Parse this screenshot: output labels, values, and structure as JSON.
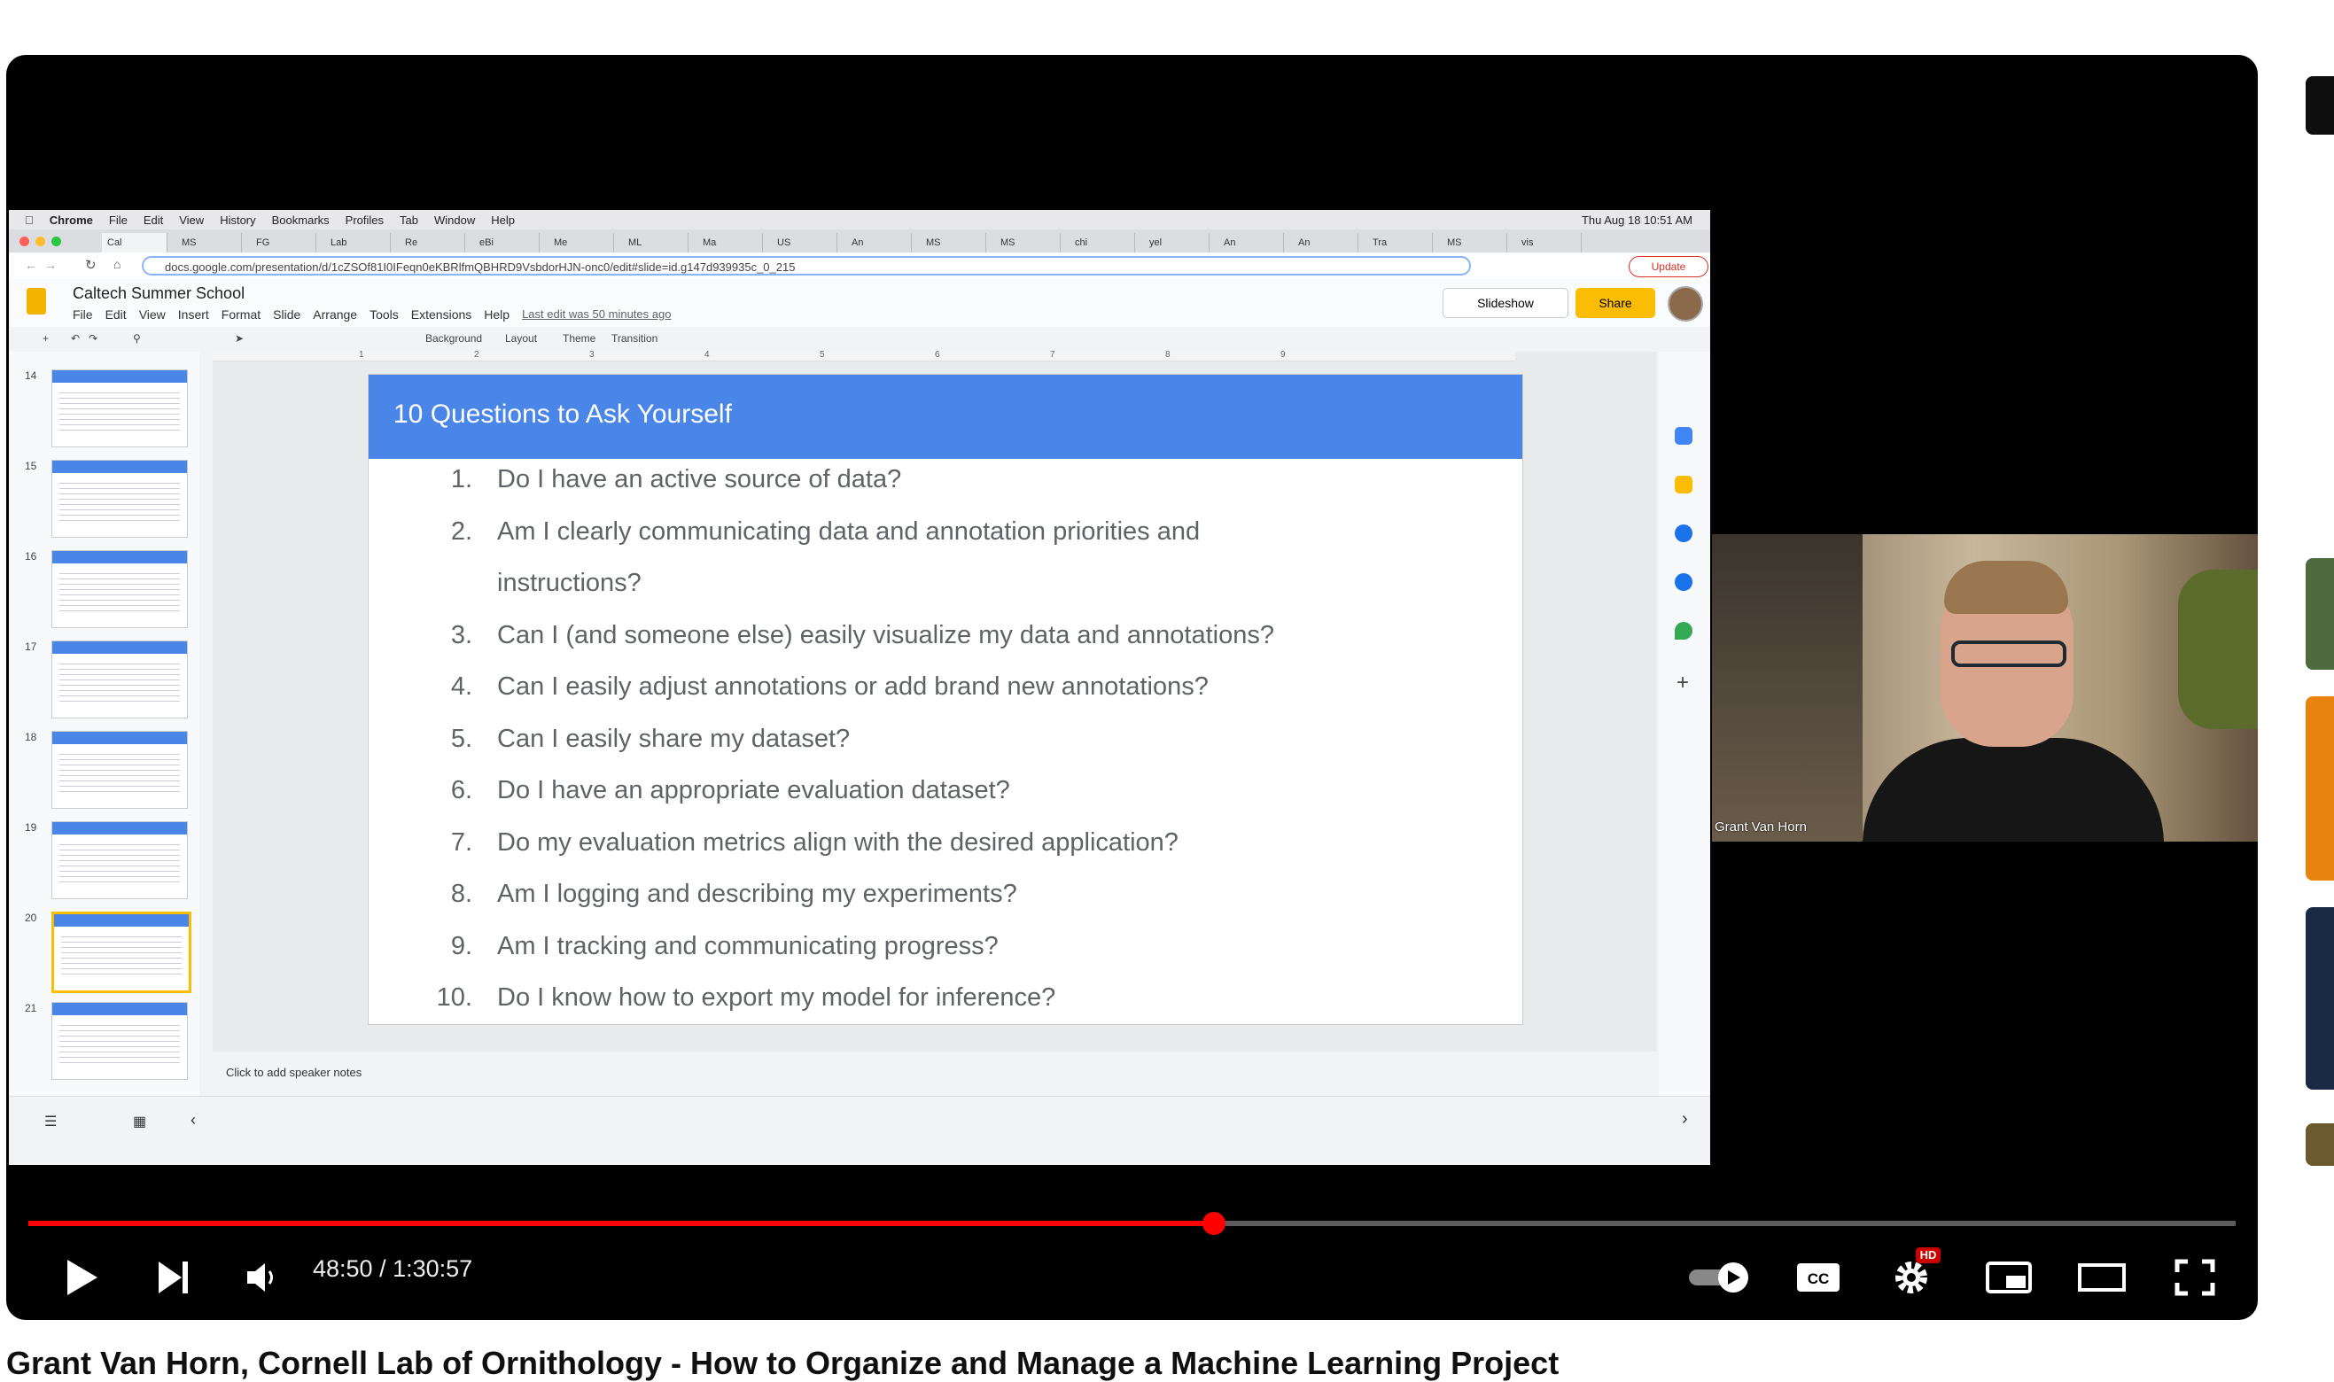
{
  "player": {
    "time_current": "48:50",
    "time_total": "1:30:57",
    "progress_fraction": 0.537,
    "hd_badge": "HD",
    "accent": "#ff0000"
  },
  "video_title": "Grant Van Horn, Cornell Lab of Ornithology - How to Organize and Manage a Machine Learning Project",
  "screen": {
    "mac_menu": [
      "Chrome",
      "File",
      "Edit",
      "View",
      "History",
      "Bookmarks",
      "Profiles",
      "Tab",
      "Window",
      "Help"
    ],
    "clock": "Thu Aug 18  10:51 AM",
    "tabs": [
      "Cal",
      "MS",
      "FG",
      "Lab",
      "Re",
      "eBi",
      "Me",
      "ML",
      "Ma",
      "US",
      "An",
      "MS",
      "MS",
      "chi",
      "yel",
      "An",
      "An",
      "Tra",
      "MS",
      "vis"
    ],
    "url": "docs.google.com/presentation/d/1cZSOf81I0IFeqn0eKBRlfmQBHRD9VsbdorHJN-onc0/edit#slide=id.g147d939935c_0_215",
    "update_label": "Update",
    "doc_title": "Caltech Summer School",
    "doc_menu": [
      "File",
      "Edit",
      "View",
      "Insert",
      "Format",
      "Slide",
      "Arrange",
      "Tools",
      "Extensions",
      "Help"
    ],
    "last_edit": "Last edit was 50 minutes ago",
    "slideshow_label": "Slideshow",
    "share_label": "Share",
    "toolbar": {
      "background": "Background",
      "layout": "Layout",
      "theme": "Theme",
      "transition": "Transition"
    },
    "slide_numbers": [
      "14",
      "15",
      "16",
      "17",
      "18",
      "19",
      "20",
      "21"
    ],
    "ruler_ticks": [
      "1",
      "2",
      "3",
      "4",
      "5",
      "6",
      "7",
      "8",
      "9"
    ],
    "slide_title": "10 Questions to Ask Yourself",
    "questions": [
      {
        "n": "1.",
        "t": "Do I have an active source of data?"
      },
      {
        "n": "2.",
        "t": "Am I clearly communicating data and annotation priorities and"
      },
      {
        "n": "",
        "t": "instructions?"
      },
      {
        "n": "3.",
        "t": "Can I (and someone else) easily visualize my data and annotations?"
      },
      {
        "n": "4.",
        "t": "Can I easily adjust annotations or add brand new annotations?"
      },
      {
        "n": "5.",
        "t": "Can I easily share my dataset?"
      },
      {
        "n": "6.",
        "t": "Do I have an appropriate evaluation dataset?"
      },
      {
        "n": "7.",
        "t": "Do my evaluation metrics align with the desired application?"
      },
      {
        "n": "8.",
        "t": "Am I logging and describing my experiments?"
      },
      {
        "n": "9.",
        "t": "Am I tracking and communicating progress?"
      },
      {
        "n": "10.",
        "t": "Do I know how to export my model for inference?"
      }
    ],
    "speaker_notes": "Click to add speaker notes"
  },
  "webcam": {
    "name": "Grant Van Horn"
  }
}
